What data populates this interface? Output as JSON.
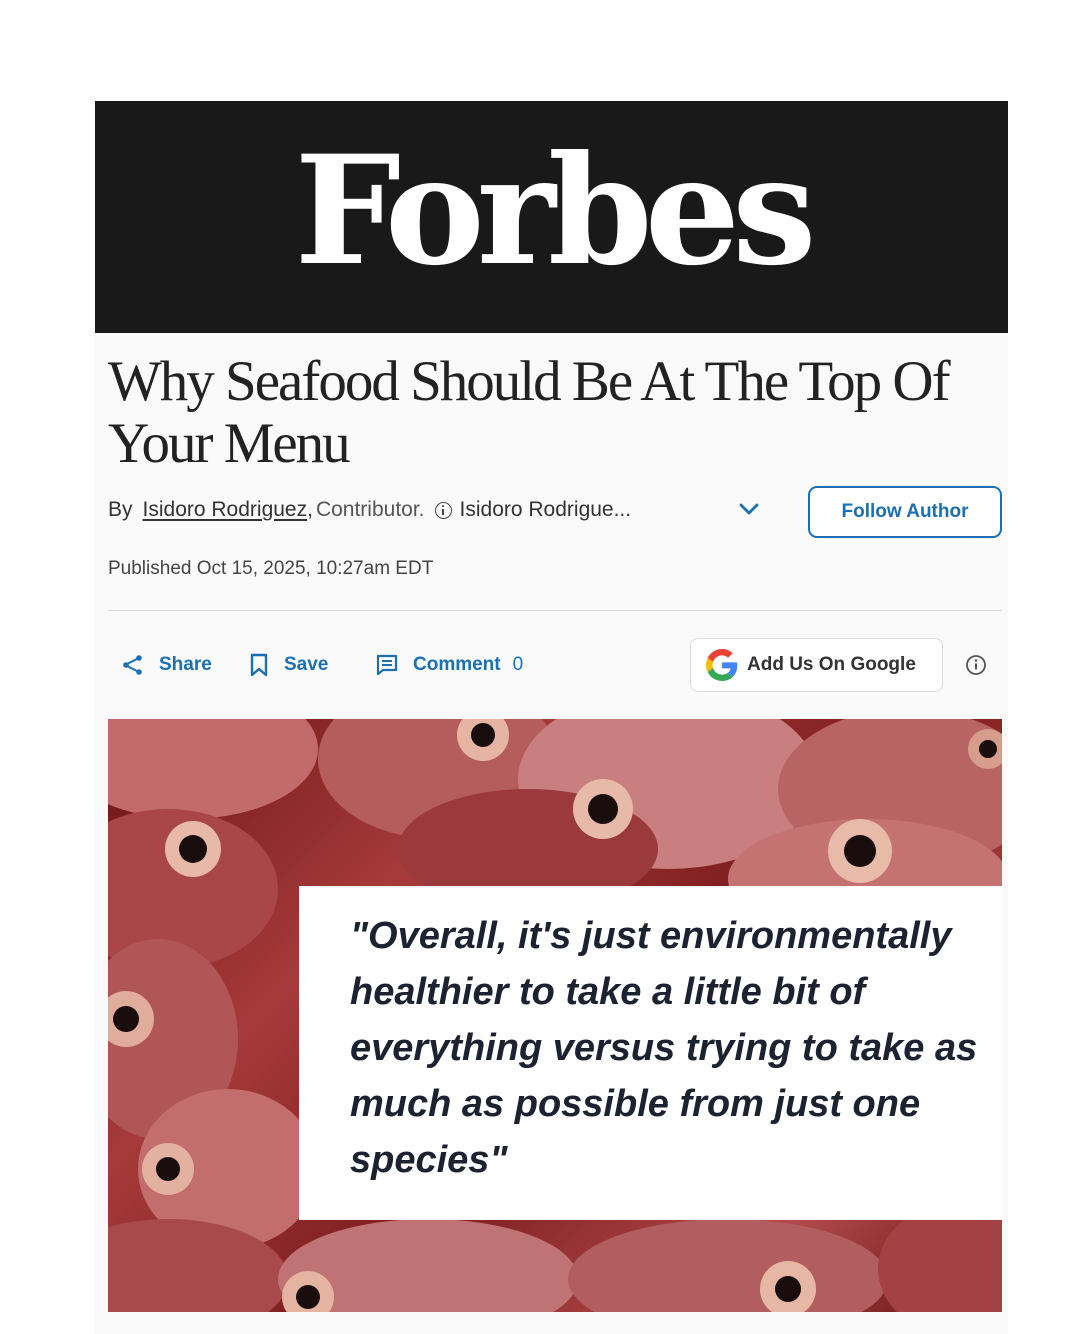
{
  "masthead": {
    "logo_text": "Forbes"
  },
  "article": {
    "headline": "Why Seafood Should Be At The Top Of Your Menu",
    "byline": {
      "prefix": "By",
      "author": "Isidoro Rodriguez",
      "separator": ",",
      "role": "Contributor.",
      "author_truncated": "Isidoro Rodrigue..."
    },
    "follow_button": "Follow Author",
    "published": "Published Oct 15, 2025, 10:27am EDT"
  },
  "actions": {
    "share_label": "Share",
    "save_label": "Save",
    "comment_label": "Comment",
    "comment_count": "0",
    "google_label": "Add Us On Google"
  },
  "hero": {
    "quote": "\"Overall, it's just environmentally healthier to take a little bit of everything versus trying to take as much as possible from just one species\""
  },
  "icons": {
    "share": "share-icon",
    "save": "bookmark-icon",
    "comment": "comment-icon",
    "google": "google-g-icon",
    "info": "info-icon",
    "chevron": "chevron-down-icon"
  },
  "colors": {
    "accent_blue": "#1b6fb3",
    "masthead_bg": "#1a1919",
    "quote_text": "#1c2230"
  }
}
